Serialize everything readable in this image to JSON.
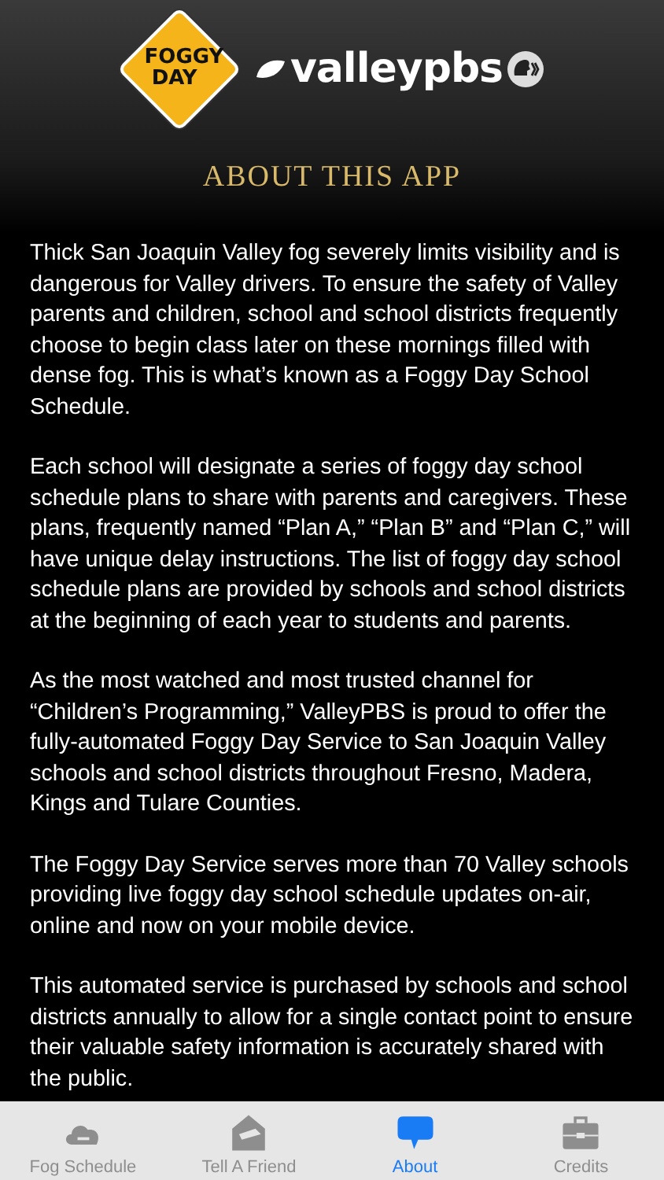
{
  "header": {
    "sign_text": [
      "FOGGY",
      "DAY"
    ],
    "brand": "valleypbs",
    "title": "ABOUT THIS APP"
  },
  "paragraphs": [
    "Thick San Joaquin Valley fog severely limits visibility and is dangerous for Valley drivers. To ensure the safety of Valley parents and children, school and school districts frequently choose to begin class later on these mornings filled with dense fog. This is what’s known as a Foggy Day School Schedule.",
    "Each school will designate a series of foggy day school schedule plans to share with parents and caregivers. These plans, frequently named “Plan A,” “Plan B” and “Plan C,” will have unique delay instructions. The list of foggy day school schedule plans are provided by schools and school districts at the beginning of each year to students and parents.",
    "As the most watched and most trusted channel for “Children’s Programming,” ValleyPBS is proud to offer the fully-automated Foggy Day Service to San Joaquin Valley schools and school districts throughout Fresno, Madera, Kings and Tulare Counties.",
    "The Foggy Day Service serves more than 70 Valley schools providing live foggy day school schedule updates on-air, online and now on your mobile device.",
    "This automated service is purchased by schools and school districts annually to allow for a single contact point to ensure their valuable safety information is accurately shared with the public."
  ],
  "tabs": [
    {
      "label": "Fog Schedule",
      "kind": "cloud",
      "selected": false
    },
    {
      "label": "Tell A Friend",
      "kind": "envelope",
      "selected": false
    },
    {
      "label": "About",
      "kind": "bubble",
      "selected": true
    },
    {
      "label": "Credits",
      "kind": "briefcase",
      "selected": false
    }
  ]
}
